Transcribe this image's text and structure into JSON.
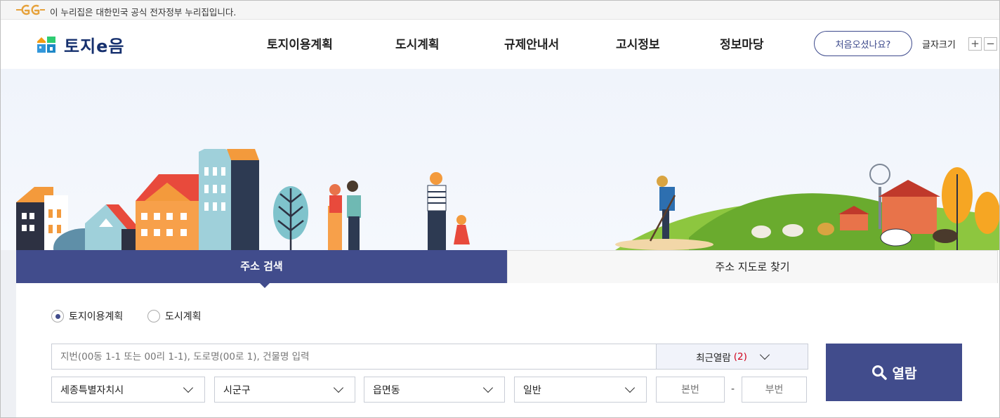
{
  "gov_banner": {
    "text": "이 누리집은 대한민국 공식 전자정부 누리집입니다.",
    "logo_icon": "egov-logo-icon"
  },
  "header": {
    "logo_text": "토지e음",
    "nav": [
      "토지이용계획",
      "도시계획",
      "규제안내서",
      "고시정보",
      "정보마당"
    ],
    "first_visit_label": "처음오셨나요?",
    "font_size_label": "글자크기",
    "font_plus": "+",
    "font_minus": "−"
  },
  "tabs": [
    {
      "label": "주소 검색",
      "active": true
    },
    {
      "label": "주소 지도로 찾기",
      "active": false
    }
  ],
  "search": {
    "radios": [
      {
        "label": "토지이용계획",
        "checked": true
      },
      {
        "label": "도시계획",
        "checked": false
      }
    ],
    "address_placeholder": "지번(00동 1-1 또는 00리 1-1), 도로명(00로 1), 건물명 입력",
    "recent_label": "최근열람",
    "recent_count": "(2)",
    "selects": [
      "세종특별자치시",
      "시군구",
      "읍면동",
      "일반"
    ],
    "main_number_placeholder": "본번",
    "sub_number_placeholder": "부번",
    "dash": "-",
    "view_button": "열람"
  },
  "colors": {
    "primary": "#414c8c",
    "logo_navy": "#16306e",
    "accent_red": "#d0021b"
  }
}
